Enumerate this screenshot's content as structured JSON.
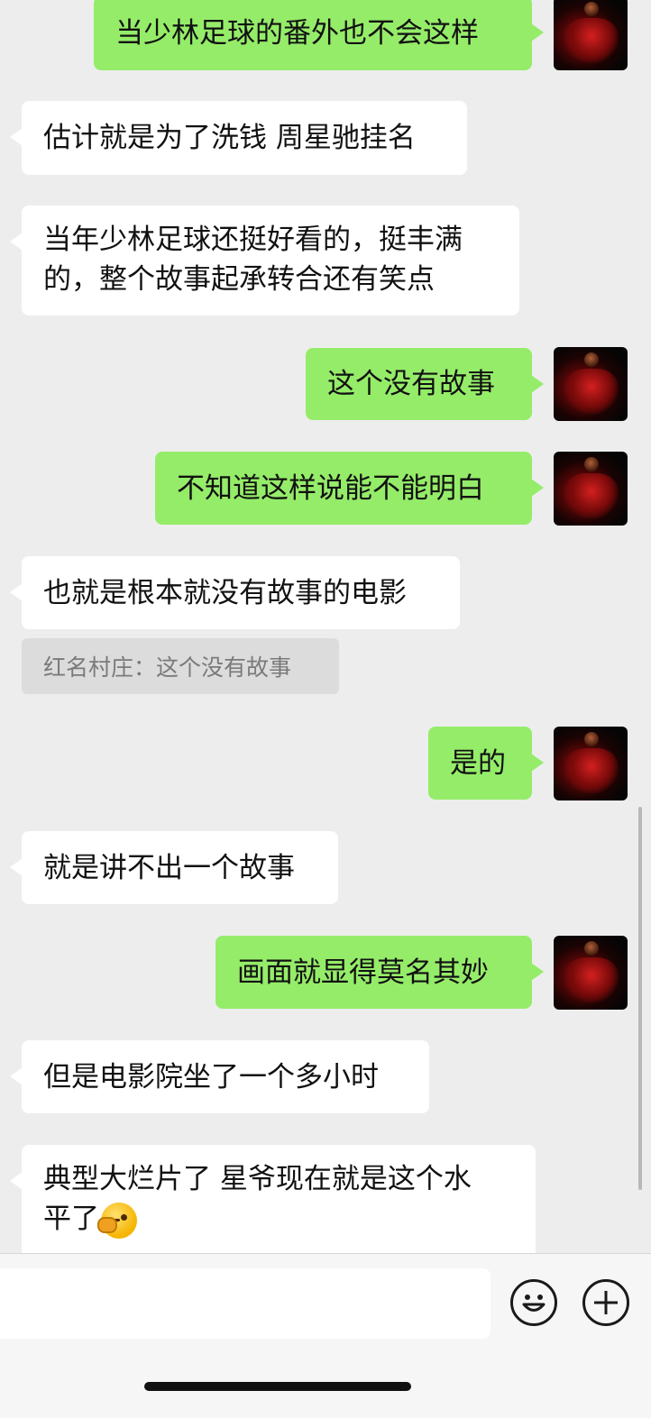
{
  "messages": [
    {
      "sender": "self",
      "text": "当少林足球的番外也不会这样"
    },
    {
      "sender": "other",
      "text": "估计就是为了洗钱 周星驰挂名"
    },
    {
      "sender": "other",
      "lines": [
        "当年少林足球还挺好看的，挺丰满",
        "的，整个故事起承转合还有笑点"
      ]
    },
    {
      "sender": "self",
      "text": "这个没有故事"
    },
    {
      "sender": "self",
      "text": "不知道这样说能不能明白"
    },
    {
      "sender": "other",
      "text": "也就是根本就没有故事的电影"
    },
    {
      "sender": "self",
      "text": "是的"
    },
    {
      "sender": "other",
      "text": "就是讲不出一个故事"
    },
    {
      "sender": "self",
      "text": "画面就显得莫名其妙"
    },
    {
      "sender": "other",
      "text": "但是电影院坐了一个多小时"
    },
    {
      "sender": "other",
      "lines": [
        "典型大烂片了  星爷现在就是这个水",
        "平了"
      ],
      "emoji": "facepalm-emoji"
    }
  ],
  "quoted_reply": "红名村庄：这个没有故事",
  "input": {
    "value": "",
    "placeholder": ""
  },
  "icons": {
    "emoji_button": "smiley-icon",
    "more_button": "plus-circle-icon"
  },
  "colors": {
    "self_bubble": "#95ec69",
    "other_bubble": "#ffffff",
    "background": "#ededed"
  }
}
